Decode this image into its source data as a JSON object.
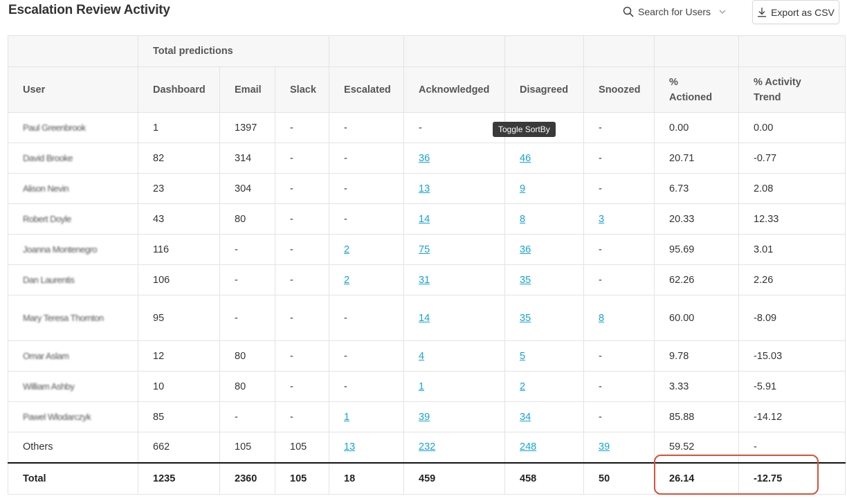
{
  "page": {
    "title": "Escalation Review Activity",
    "search_label": "Search for Users",
    "export_label": "Export as CSV",
    "tooltip": "Toggle SortBy"
  },
  "icons": {
    "search": "search-icon",
    "chevron": "chevron-down-icon",
    "export": "download-icon"
  },
  "colors": {
    "link": "#14a3d6",
    "highlight": "#d8503a",
    "header_bg": "#f7f7f7"
  },
  "table": {
    "group_header": "Total predictions",
    "columns": {
      "user": "User",
      "dashboard": "Dashboard",
      "email": "Email",
      "slack": "Slack",
      "escalated": "Escalated",
      "acknowledged": "Acknowledged",
      "disagreed": "Disagreed",
      "snoozed": "Snoozed",
      "actioned_line1": "%",
      "actioned_line2": "Actioned",
      "trend_line1": "% Activity",
      "trend_line2": "Trend"
    },
    "rows": [
      {
        "user": "Paul Greenbrook",
        "dashboard": "1",
        "email": "1397",
        "slack": "-",
        "escalated": "-",
        "acknowledged": "-",
        "disagreed": "",
        "snoozed": "-",
        "actioned": "0.00",
        "trend": "0.00"
      },
      {
        "user": "David Brooke",
        "dashboard": "82",
        "email": "314",
        "slack": "-",
        "escalated": "-",
        "acknowledged": "36",
        "disagreed": "46",
        "snoozed": "-",
        "actioned": "20.71",
        "trend": "-0.77"
      },
      {
        "user": "Alison Nevin",
        "dashboard": "23",
        "email": "304",
        "slack": "-",
        "escalated": "-",
        "acknowledged": "13",
        "disagreed": "9",
        "snoozed": "-",
        "actioned": "6.73",
        "trend": "2.08"
      },
      {
        "user": "Robert Doyle",
        "dashboard": "43",
        "email": "80",
        "slack": "-",
        "escalated": "-",
        "acknowledged": "14",
        "disagreed": "8",
        "snoozed": "3",
        "actioned": "20.33",
        "trend": "12.33"
      },
      {
        "user": "Joanna Montenegro",
        "dashboard": "116",
        "email": "-",
        "slack": "-",
        "escalated": "2",
        "acknowledged": "75",
        "disagreed": "36",
        "snoozed": "-",
        "actioned": "95.69",
        "trend": "3.01"
      },
      {
        "user": "Dan Laurentis",
        "dashboard": "106",
        "email": "-",
        "slack": "-",
        "escalated": "2",
        "acknowledged": "31",
        "disagreed": "35",
        "snoozed": "-",
        "actioned": "62.26",
        "trend": "2.26"
      },
      {
        "user": "Mary Teresa Thornton",
        "dashboard": "95",
        "email": "-",
        "slack": "-",
        "escalated": "-",
        "acknowledged": "14",
        "disagreed": "35",
        "snoozed": "8",
        "actioned": "60.00",
        "trend": "-8.09"
      },
      {
        "user": "Omar Aslam",
        "dashboard": "12",
        "email": "80",
        "slack": "-",
        "escalated": "-",
        "acknowledged": "4",
        "disagreed": "5",
        "snoozed": "-",
        "actioned": "9.78",
        "trend": "-15.03"
      },
      {
        "user": "William Ashby",
        "dashboard": "10",
        "email": "80",
        "slack": "-",
        "escalated": "-",
        "acknowledged": "1",
        "disagreed": "2",
        "snoozed": "-",
        "actioned": "3.33",
        "trend": "-5.91"
      },
      {
        "user": "Pawel Wlodarczyk",
        "dashboard": "85",
        "email": "-",
        "slack": "-",
        "escalated": "1",
        "acknowledged": "39",
        "disagreed": "34",
        "snoozed": "-",
        "actioned": "85.88",
        "trend": "-14.12"
      },
      {
        "user": "Others",
        "dashboard": "662",
        "email": "105",
        "slack": "105",
        "escalated": "13",
        "acknowledged": "232",
        "disagreed": "248",
        "snoozed": "39",
        "actioned": "59.52",
        "trend": "-"
      }
    ],
    "total": {
      "user": "Total",
      "dashboard": "1235",
      "email": "2360",
      "slack": "105",
      "escalated": "18",
      "acknowledged": "459",
      "disagreed": "458",
      "snoozed": "50",
      "actioned": "26.14",
      "trend": "-12.75"
    }
  }
}
